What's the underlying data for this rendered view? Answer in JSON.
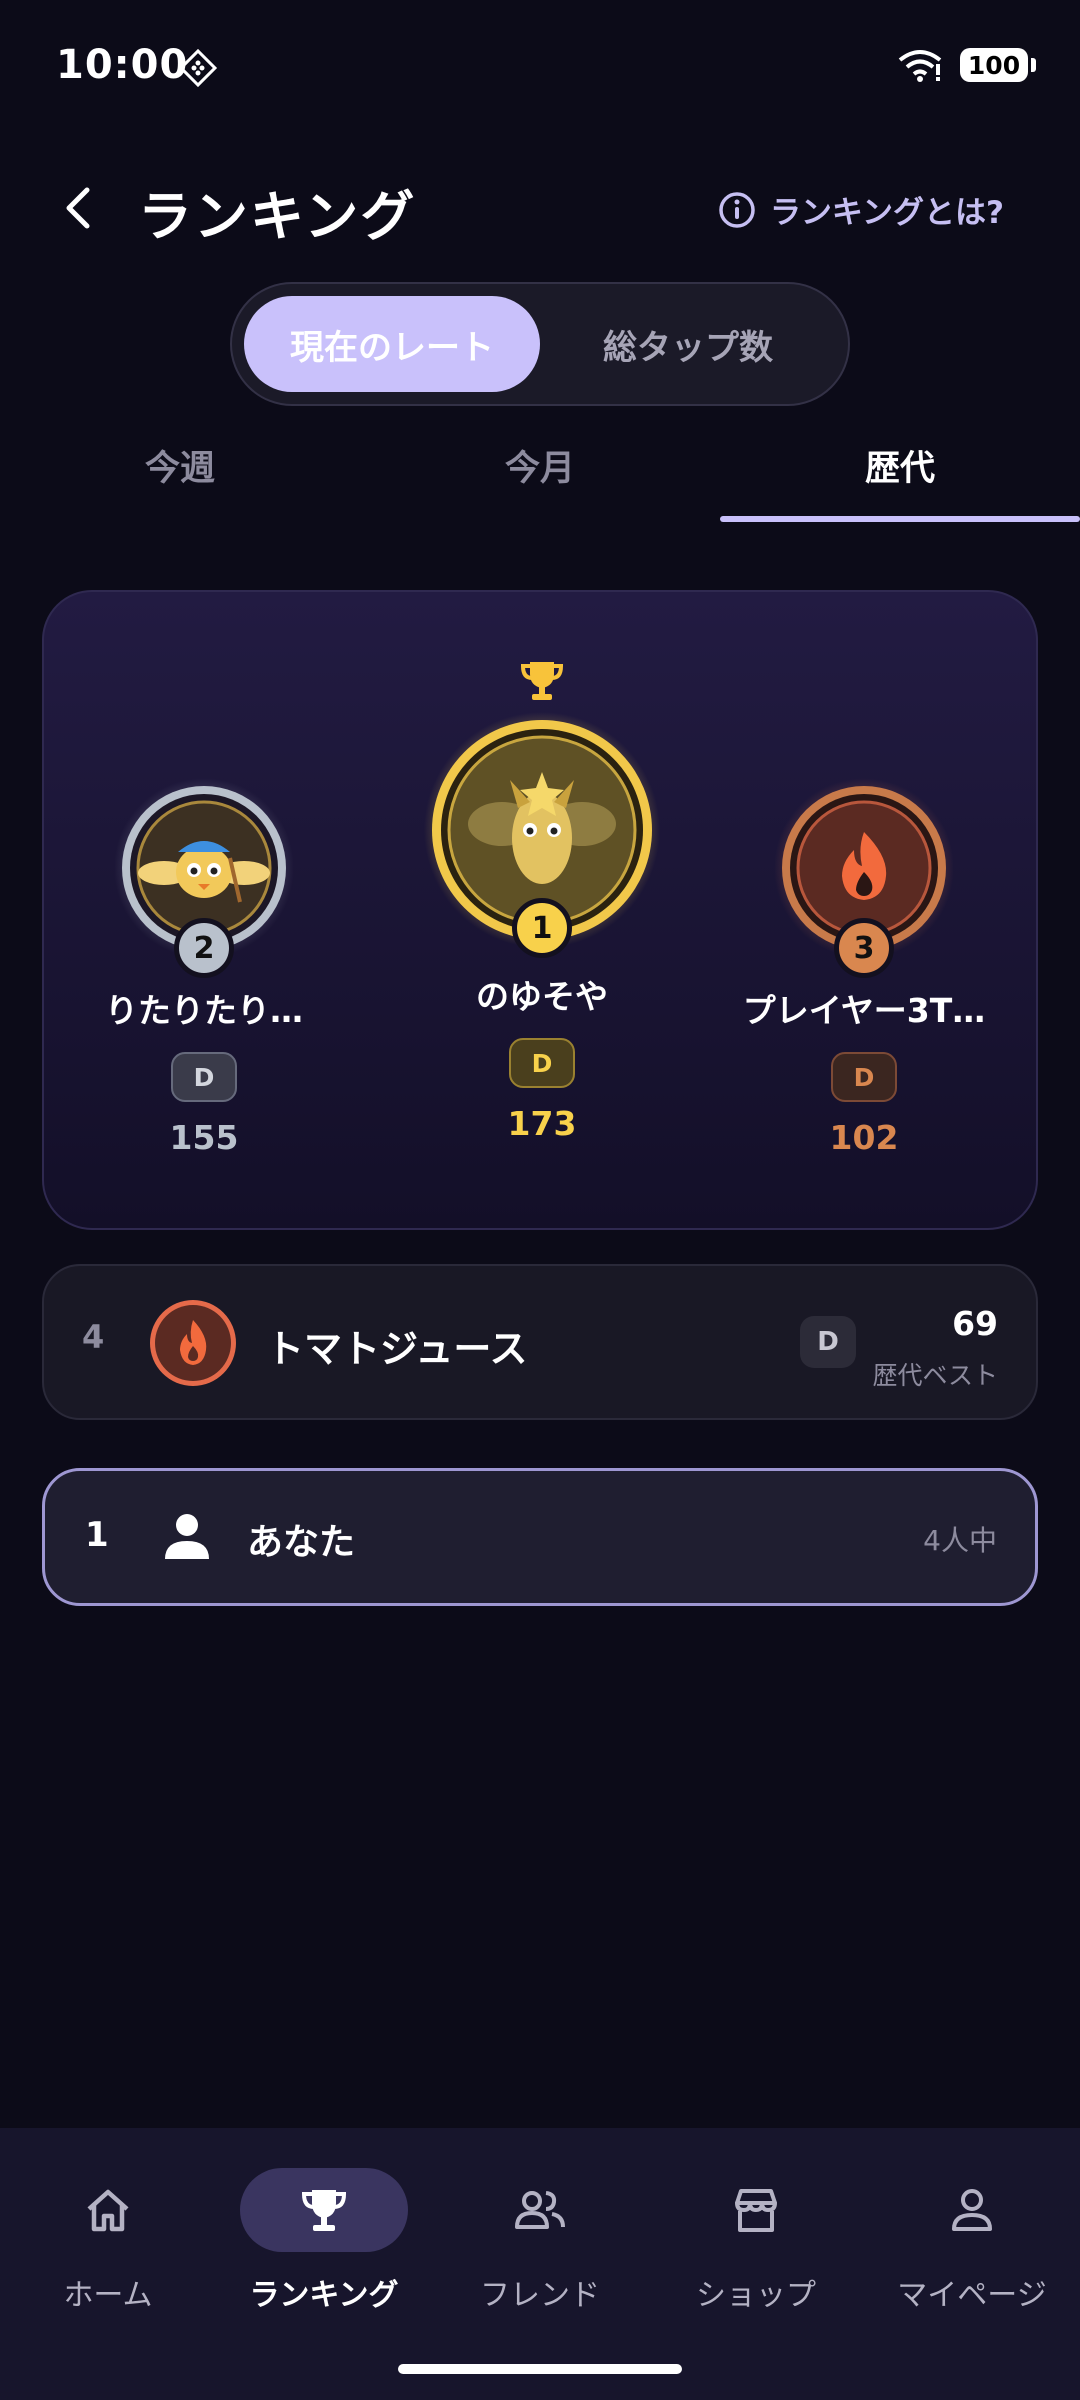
{
  "status": {
    "time": "10:00",
    "battery": "100"
  },
  "header": {
    "title": "ランキング",
    "help_label": "ランキングとは?"
  },
  "segment": {
    "options": [
      "現在のレート",
      "総タップ数"
    ],
    "selected": "現在のレート"
  },
  "period_tabs": {
    "items": [
      "今週",
      "今月",
      "歴代"
    ],
    "selected": "歴代"
  },
  "podium": [
    {
      "rank": "2",
      "name": "りたりたり…",
      "tier": "D",
      "score": "155"
    },
    {
      "rank": "1",
      "name": "のゆそや",
      "tier": "D",
      "score": "173"
    },
    {
      "rank": "3",
      "name": "プレイヤー3T…",
      "tier": "D",
      "score": "102"
    }
  ],
  "list": [
    {
      "rank": "4",
      "name": "トマトジュース",
      "tier": "D",
      "score": "69",
      "sub": "歴代ベスト"
    }
  ],
  "me": {
    "rank": "1",
    "name": "あなた",
    "of_total": "4人中"
  },
  "nav": {
    "items": [
      {
        "label": "ホーム",
        "icon": "home-icon"
      },
      {
        "label": "ランキング",
        "icon": "trophy-icon"
      },
      {
        "label": "フレンド",
        "icon": "friends-icon"
      },
      {
        "label": "ショップ",
        "icon": "shop-icon"
      },
      {
        "label": "マイページ",
        "icon": "person-icon"
      }
    ],
    "selected": "ランキング"
  },
  "colors": {
    "accent": "#c9c1fb",
    "gold": "#f8d14b",
    "silver": "#b9c1cc",
    "bronze": "#d9874f",
    "background": "#0c0b18"
  }
}
